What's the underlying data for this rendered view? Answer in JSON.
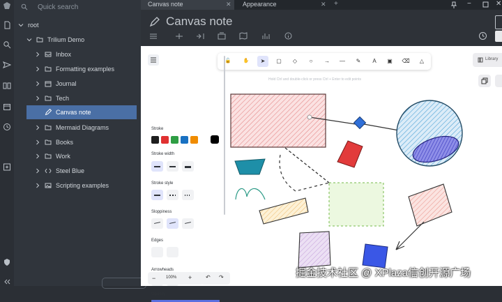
{
  "search": {
    "placeholder": "Quick search"
  },
  "tree": [
    {
      "label": "root",
      "depth": 0,
      "icon": "chevron-down-icon"
    },
    {
      "label": "Trilium Demo",
      "depth": 1,
      "icon": "folder-icon"
    },
    {
      "label": "Inbox",
      "depth": 2,
      "icon": "inbox-icon"
    },
    {
      "label": "Formatting examples",
      "depth": 2,
      "icon": "folder-icon"
    },
    {
      "label": "Journal",
      "depth": 2,
      "icon": "calendar-icon"
    },
    {
      "label": "Tech",
      "depth": 2,
      "icon": "folder-icon"
    },
    {
      "label": "Canvas note",
      "depth": 2,
      "icon": "pen-icon",
      "active": true
    },
    {
      "label": "Mermaid Diagrams",
      "depth": 2,
      "icon": "folder-icon"
    },
    {
      "label": "Books",
      "depth": 2,
      "icon": "folder-icon"
    },
    {
      "label": "Work",
      "depth": 2,
      "icon": "folder-icon"
    },
    {
      "label": "Steel Blue",
      "depth": 2,
      "icon": "code-icon"
    },
    {
      "label": "Scripting examples",
      "depth": 2,
      "icon": "image-icon"
    }
  ],
  "tabs": [
    {
      "label": "Canvas note",
      "active": true
    },
    {
      "label": "Appearance",
      "active": false
    }
  ],
  "note": {
    "title": "Canvas note"
  },
  "canvas_toolbar": {
    "tools": [
      "lock-icon",
      "hand-icon",
      "pointer-icon",
      "rectangle-icon",
      "diamond-icon",
      "ellipse-icon",
      "arrow-icon",
      "line-icon",
      "pencil-icon",
      "text-icon",
      "image-icon",
      "eraser-icon",
      "more-shapes-icon"
    ],
    "selected_tool": "pointer-icon",
    "hint": "Hold Ctrl and double-click or press Ctrl + Enter to edit points",
    "library_label": "Library"
  },
  "properties": {
    "stroke_label": "Stroke",
    "stroke_colors": [
      "#1e1e1e",
      "#e03131",
      "#2f9e44",
      "#1971c2",
      "#f08c00"
    ],
    "stroke_current": "#000000",
    "stroke_width_label": "Stroke width",
    "stroke_style_label": "Stroke style",
    "sloppiness_label": "Sloppiness",
    "edges_label": "Edges",
    "arrowheads_label": "Arrowheads",
    "opacity_label": "Opacity",
    "opacity": 100
  },
  "zoom": {
    "value": "100%",
    "minus": "−",
    "plus": "+"
  },
  "watermark": "掘金技术社区 @ XPlaza信创开源广场"
}
